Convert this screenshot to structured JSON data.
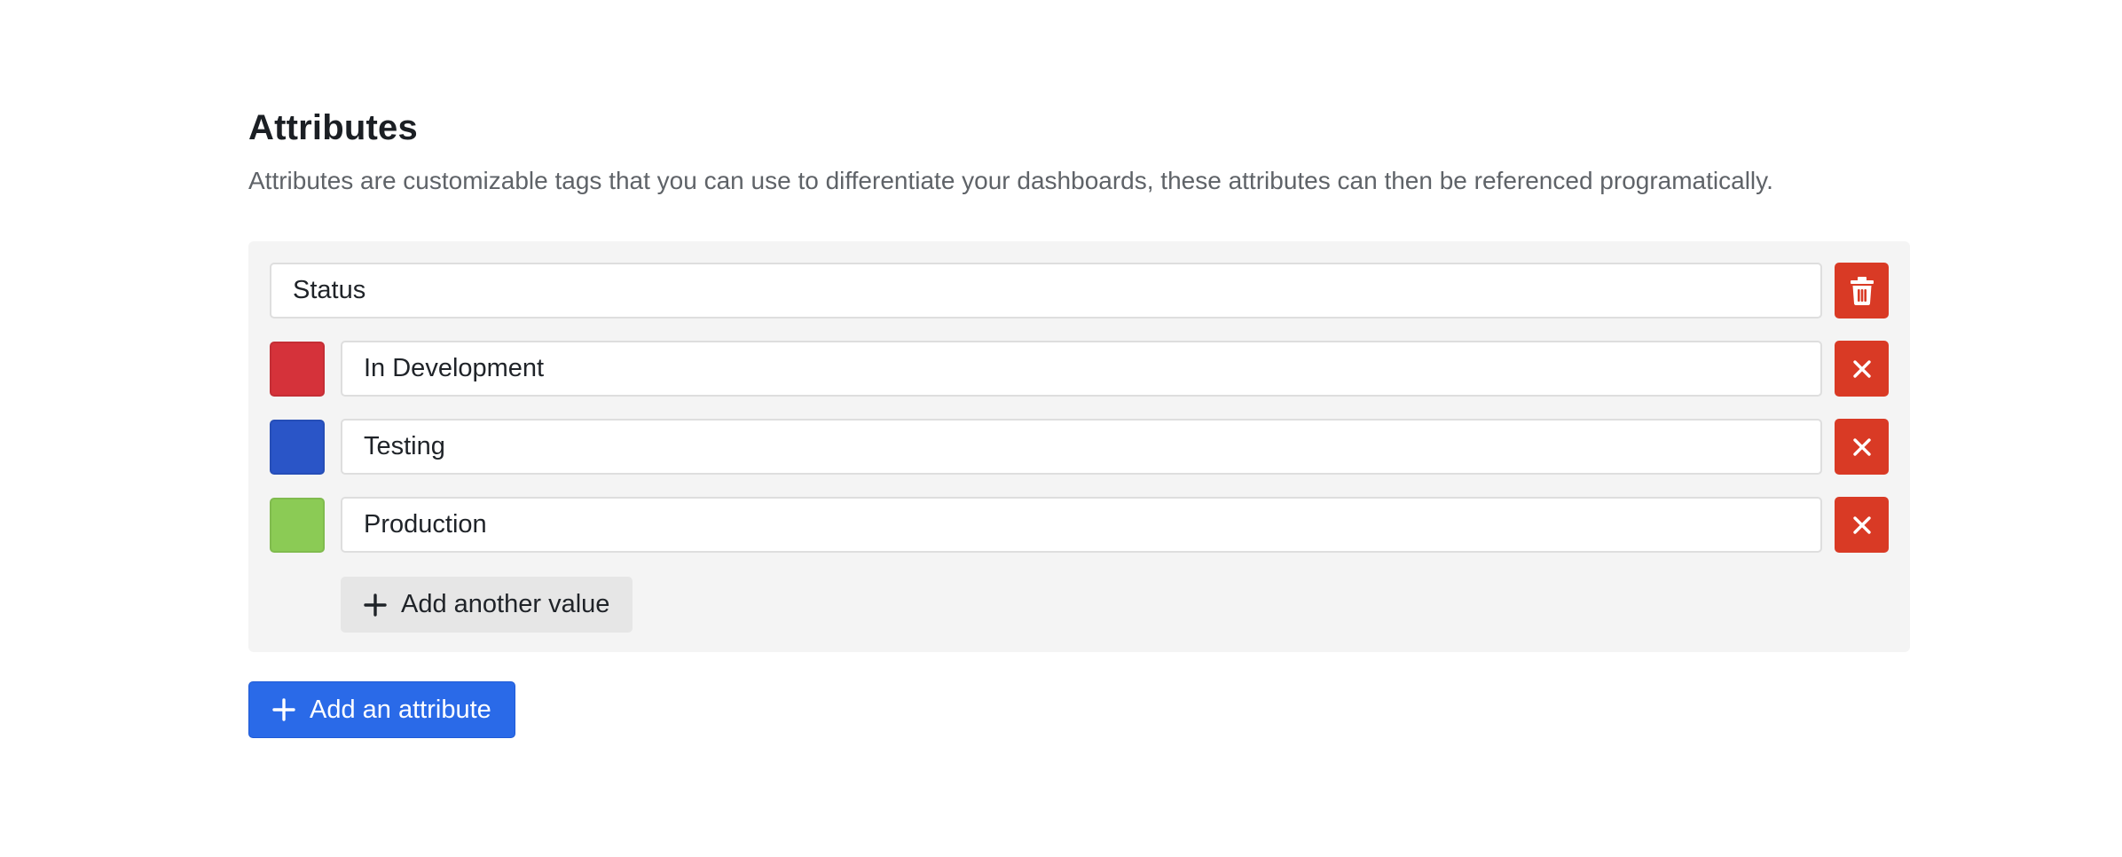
{
  "header": {
    "title": "Attributes",
    "description": "Attributes are customizable tags that you can use to differentiate your dashboards, these attributes can then be referenced programatically."
  },
  "attribute": {
    "name_value": "Status",
    "delete_icon": "trash-icon",
    "values": [
      {
        "label": "In Development",
        "color": "#d5323a",
        "remove_icon": "close-icon"
      },
      {
        "label": "Testing",
        "color": "#2a55c7",
        "remove_icon": "close-icon"
      },
      {
        "label": "Production",
        "color": "#8bcb55",
        "remove_icon": "close-icon"
      }
    ],
    "add_value_label": "Add another value",
    "add_value_icon": "plus-icon"
  },
  "actions": {
    "add_attribute_label": "Add an attribute",
    "add_attribute_icon": "plus-icon"
  },
  "colors": {
    "danger": "#d93a25",
    "primary": "#2a6ae8",
    "panel_bg": "#f4f4f4"
  }
}
